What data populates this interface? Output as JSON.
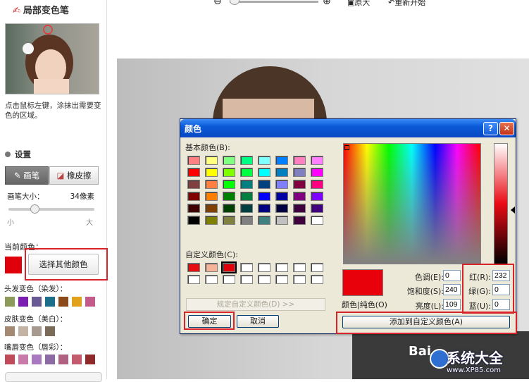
{
  "panel": {
    "title": "局部变色笔",
    "hint": "点击鼠标左键，涂抹出需要变色的区域。",
    "settings_label": "设置",
    "brush_tab": "画笔",
    "eraser_tab": "橡皮擦",
    "brush_size_label": "画笔大小：",
    "brush_size_value": "34像素",
    "size_min": "小",
    "size_max": "大",
    "brush_size_fraction": 0.3,
    "current_color_label": "当前颜色：",
    "current_color": "#e0000a",
    "other_color_button": "选择其他颜色",
    "hair_label": "头发变色（染发）：",
    "hair_colors": [
      "#8c9a5a",
      "#7a1fb0",
      "#6a5a94",
      "#1c6f8a",
      "#8b4a18",
      "#e2a11a",
      "#c45a8c"
    ],
    "skin_label": "皮肤变色（美白）：",
    "skin_colors": [
      "#a48a72",
      "#c2b3a4",
      "#a69a8e",
      "#7a6a58"
    ],
    "lip_label": "嘴唇变色（唇彩）：",
    "lip_colors": [
      "#c04a5a",
      "#c87aa8",
      "#a878c0",
      "#8c6aa4",
      "#b06080",
      "#c45a6e",
      "#902a2a"
    ]
  },
  "toolbar": {
    "zoom_out_icon": "zoom-out-icon",
    "zoom_in_icon": "zoom-in-icon",
    "original_label": "原大",
    "restart_label": "重新开始"
  },
  "watermark": {
    "text1": "Bai",
    "site_name": "系统大全",
    "site_url": "www.XP85.com"
  },
  "dialog": {
    "title": "颜色",
    "help": "?",
    "close": "✕",
    "basic_colors_label": "基本颜色(B):",
    "basic_colors": [
      [
        "#ff8080",
        "#ffff80",
        "#80ff80",
        "#00ff80",
        "#80ffff",
        "#0080ff",
        "#ff80c0",
        "#ff80ff"
      ],
      [
        "#ff0000",
        "#ffff00",
        "#80ff00",
        "#00ff40",
        "#00ffff",
        "#0080c0",
        "#8080c0",
        "#ff00ff"
      ],
      [
        "#804040",
        "#ff8040",
        "#00ff00",
        "#008080",
        "#004080",
        "#8080ff",
        "#800040",
        "#ff0080"
      ],
      [
        "#800000",
        "#ff8000",
        "#008000",
        "#008040",
        "#0000ff",
        "#0000a0",
        "#800080",
        "#8000ff"
      ],
      [
        "#400000",
        "#804000",
        "#004000",
        "#004040",
        "#000080",
        "#000040",
        "#400040",
        "#400080"
      ],
      [
        "#000000",
        "#808000",
        "#808040",
        "#808080",
        "#408080",
        "#c0c0c0",
        "#400040",
        "#ffffff"
      ]
    ],
    "custom_colors_label": "自定义颜色(C):",
    "custom_colors": [
      [
        "#e60e0e",
        "#f5b49a",
        "#e0000a",
        "#ffffff",
        "#ffffff",
        "#ffffff",
        "#ffffff",
        "#ffffff"
      ],
      [
        "#ffffff",
        "#ffffff",
        "#ffffff",
        "#ffffff",
        "#ffffff",
        "#ffffff",
        "#ffffff",
        "#ffffff"
      ]
    ],
    "define_custom_button": "规定自定义颜色(D) >>",
    "ok_button": "确定",
    "cancel_button": "取消",
    "color_solid_label": "颜色|纯色(O)",
    "hue_label": "色调(E):",
    "hue_value": "0",
    "sat_label": "饱和度(S):",
    "sat_value": "240",
    "lum_label": "亮度(L):",
    "lum_value": "109",
    "red_label": "红(R):",
    "red_value": "232",
    "green_label": "绿(G):",
    "green_value": "0",
    "blue_label": "蓝(U):",
    "blue_value": "0",
    "add_custom_button": "添加到自定义颜色(A)",
    "preview_color": "#e8000a"
  }
}
